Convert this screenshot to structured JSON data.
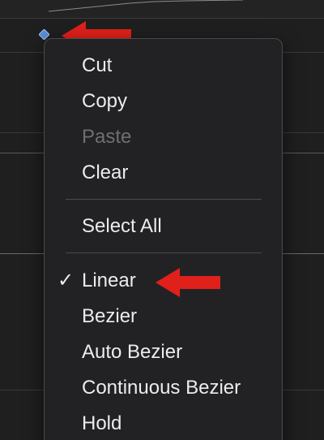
{
  "menu": {
    "items": [
      {
        "label": "Cut",
        "enabled": true,
        "checked": false
      },
      {
        "label": "Copy",
        "enabled": true,
        "checked": false
      },
      {
        "label": "Paste",
        "enabled": false,
        "checked": false
      },
      {
        "label": "Clear",
        "enabled": true,
        "checked": false
      },
      {
        "label": "Select All",
        "enabled": true,
        "checked": false
      },
      {
        "label": "Linear",
        "enabled": true,
        "checked": true
      },
      {
        "label": "Bezier",
        "enabled": true,
        "checked": false
      },
      {
        "label": "Auto Bezier",
        "enabled": true,
        "checked": false
      },
      {
        "label": "Continuous Bezier",
        "enabled": true,
        "checked": false
      },
      {
        "label": "Hold",
        "enabled": true,
        "checked": false
      }
    ],
    "check_glyph": "✓"
  },
  "colors": {
    "arrow": "#e0201b",
    "keyframe": "#5a8fd6",
    "menu_bg": "#222225",
    "menu_text": "#ececec",
    "disabled_text": "#6f6f72"
  },
  "icons": {
    "keyframe": "keyframe-diamond-icon",
    "annotation_arrow": "red-arrow-icon",
    "check": "checkmark-icon"
  }
}
